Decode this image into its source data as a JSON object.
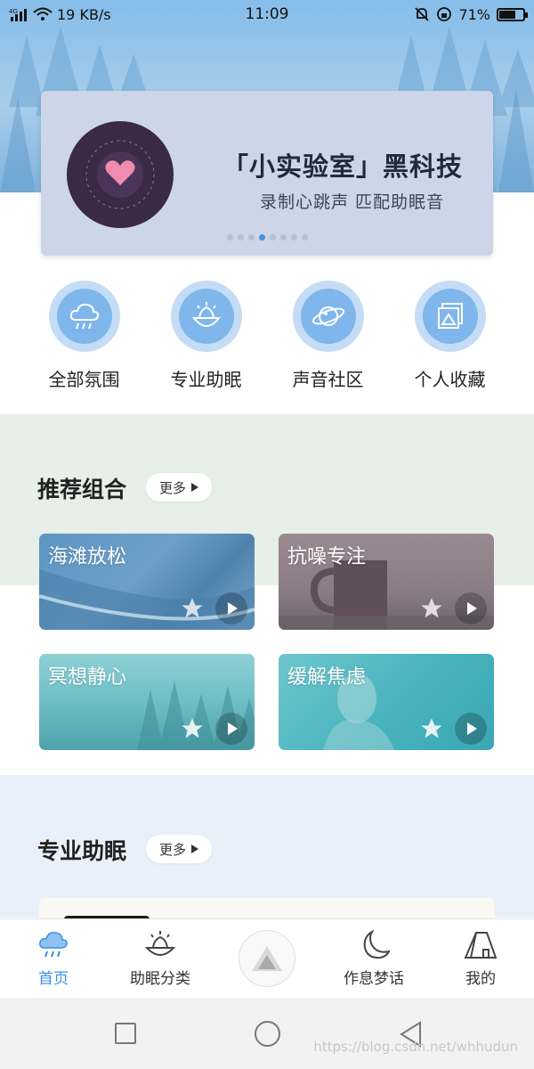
{
  "status_bar": {
    "network": "4G",
    "speed": "19 KB/s",
    "time": "11:09",
    "battery_percent": "71%",
    "battery_level": 0.71
  },
  "banner": {
    "title": "「小实验室」黑科技",
    "subtitle": "录制心跳声  匹配助眠音",
    "page_count": 8,
    "active_page": 3
  },
  "quick_links": [
    {
      "label": "全部氛围",
      "icon": "rain-cloud-icon"
    },
    {
      "label": "专业助眠",
      "icon": "lotus-icon"
    },
    {
      "label": "声音社区",
      "icon": "planet-icon"
    },
    {
      "label": "个人收藏",
      "icon": "photo-album-icon"
    }
  ],
  "recommend": {
    "title": "推荐组合",
    "more_label": "更多",
    "tiles": [
      {
        "label": "海滩放松"
      },
      {
        "label": "抗噪专注"
      },
      {
        "label": "冥想静心"
      },
      {
        "label": "缓解焦虑"
      }
    ]
  },
  "pro_sleep": {
    "title": "专业助眠",
    "more_label": "更多"
  },
  "bottom_nav": [
    {
      "label": "首页",
      "icon": "rain-cloud-icon",
      "active": true
    },
    {
      "label": "助眠分类",
      "icon": "lotus-icon",
      "active": false
    },
    {
      "label": "",
      "icon": "triangle-logo-icon",
      "active": false
    },
    {
      "label": "作息梦话",
      "icon": "moon-icon",
      "active": false
    },
    {
      "label": "我的",
      "icon": "tent-icon",
      "active": false
    }
  ],
  "watermark": "https://blog.csdn.net/whhudun",
  "colors": {
    "accent": "#3b8ee6",
    "quick_icon_bg": "#7fb6ec",
    "recommend_bg": "#e6efe8",
    "pro_bg": "#e8f0f9"
  }
}
